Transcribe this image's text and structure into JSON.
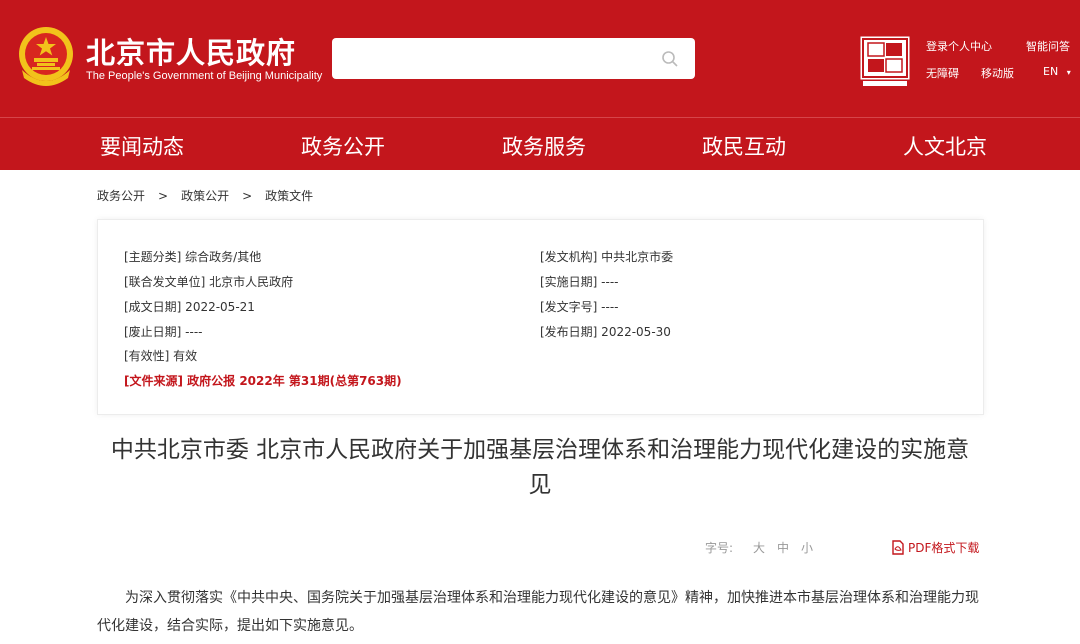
{
  "header": {
    "title": "北京市人民政府",
    "subtitle": "The People's Government of Beijing Municipality",
    "search_placeholder": "",
    "links": {
      "user_center": "登录个人中心",
      "smart_qa": "智能问答",
      "accessibility": "无障碍",
      "mobile": "移动版",
      "language": "EN"
    }
  },
  "nav": [
    "要闻动态",
    "政务公开",
    "政务服务",
    "政民互动",
    "人文北京"
  ],
  "breadcrumb": [
    "政务公开",
    "政策公开",
    "政策文件"
  ],
  "breadcrumb_sep": ">",
  "meta": {
    "left": [
      "[主题分类] 综合政务/其他",
      "[联合发文单位] 北京市人民政府",
      "[成文日期] 2022-05-21",
      "[废止日期] ----",
      "[有效性] 有效"
    ],
    "right": [
      "[发文机构] 中共北京市委",
      "[实施日期] ----",
      "[发文字号] ----",
      "[发布日期] 2022-05-30"
    ],
    "source": "[文件来源] 政府公报 2022年 第31期(总第763期)"
  },
  "title": "中共北京市委 北京市人民政府关于加强基层治理体系和治理能力现代化建设的实施意见",
  "font_size": {
    "label": "字号:",
    "large": "大",
    "medium": "中",
    "small": "小"
  },
  "pdf_label": "PDF格式下载",
  "body": "为深入贯彻落实《中共中央、国务院关于加强基层治理体系和治理能力现代化建设的意见》精神，加快推进本市基层治理体系和治理能力现代化建设，结合实际，提出如下实施意见。",
  "colors": {
    "brand_red": "#c3161c",
    "gold": "#f2c21b"
  }
}
